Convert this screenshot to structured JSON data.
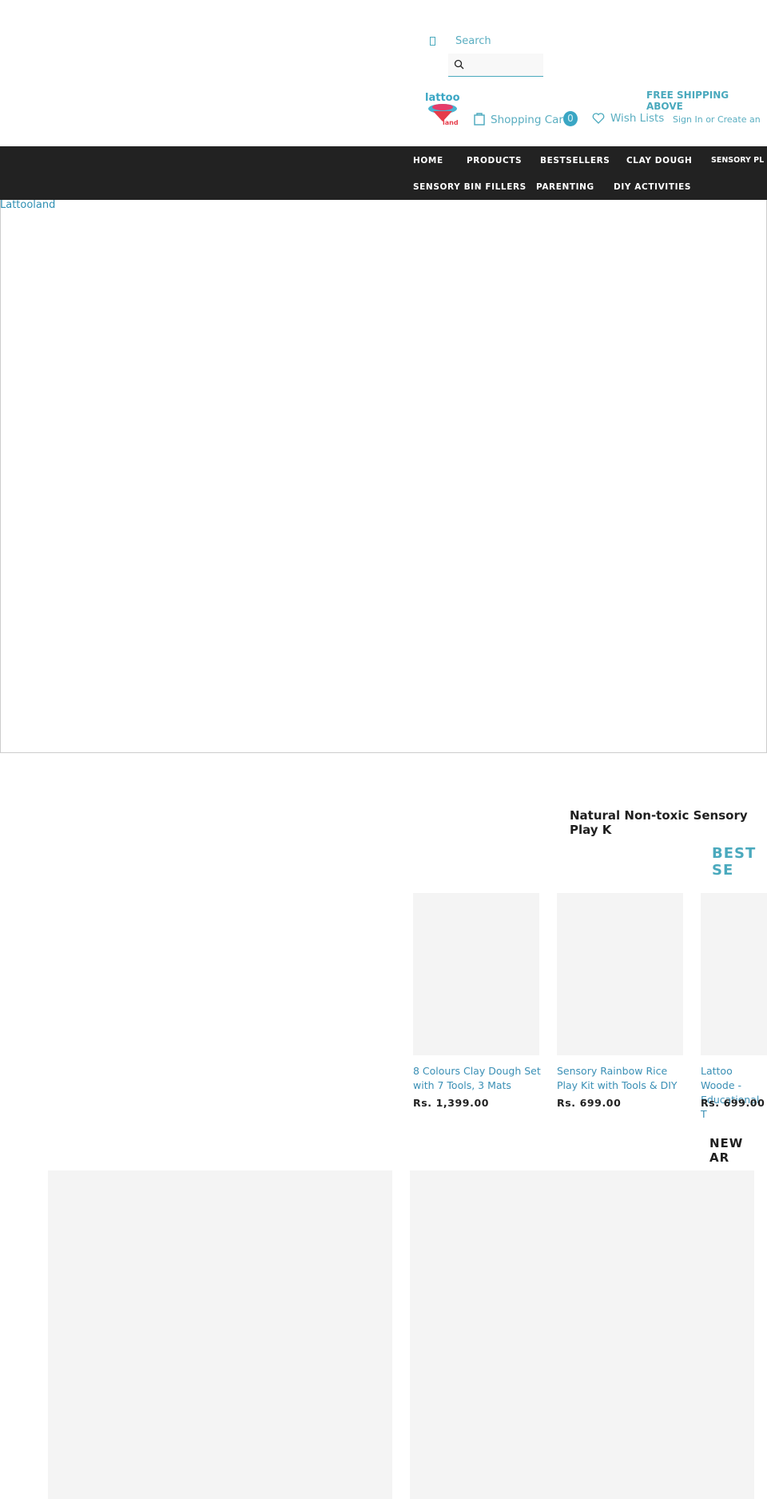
{
  "header": {
    "search_label": "Search",
    "search_placeholder": "",
    "logo_text": "lattoo land",
    "shipping_banner": "FREE SHIPPING ABOVE",
    "cart_label": "Shopping Cart",
    "cart_count": "0",
    "wishlist_label": "Wish Lists",
    "signin_label": "Sign In or Create an"
  },
  "nav": {
    "items": [
      {
        "label": "HOME"
      },
      {
        "label": "PRODUCTS"
      },
      {
        "label": "BESTSELLERS"
      },
      {
        "label": "CLAY DOUGH"
      },
      {
        "label": "SENSORY PL"
      },
      {
        "label": "SENSORY BIN FILLERS"
      },
      {
        "label": "PARENTING"
      },
      {
        "label": "DIY ACTIVITIES"
      }
    ]
  },
  "hero": {
    "link_text": "Lattooland"
  },
  "main": {
    "tagline": "Natural Non-toxic Sensory Play K",
    "bestsellers_title": "BEST SE",
    "products": [
      {
        "title": "8 Colours Clay Dough Set with 7 Tools, 3 Mats",
        "price": "Rs. 1,399.00"
      },
      {
        "title": "Sensory Rainbow Rice Play Kit with Tools & DIY",
        "price": "Rs. 699.00"
      },
      {
        "title": "Lattoo Woode - Educational T",
        "price": "Rs. 699.00"
      }
    ],
    "new_arrivals_title": "NEW AR"
  },
  "colors": {
    "accent": "#4aa9bd",
    "nav_bg": "#222222",
    "link": "#3a8fb5"
  }
}
